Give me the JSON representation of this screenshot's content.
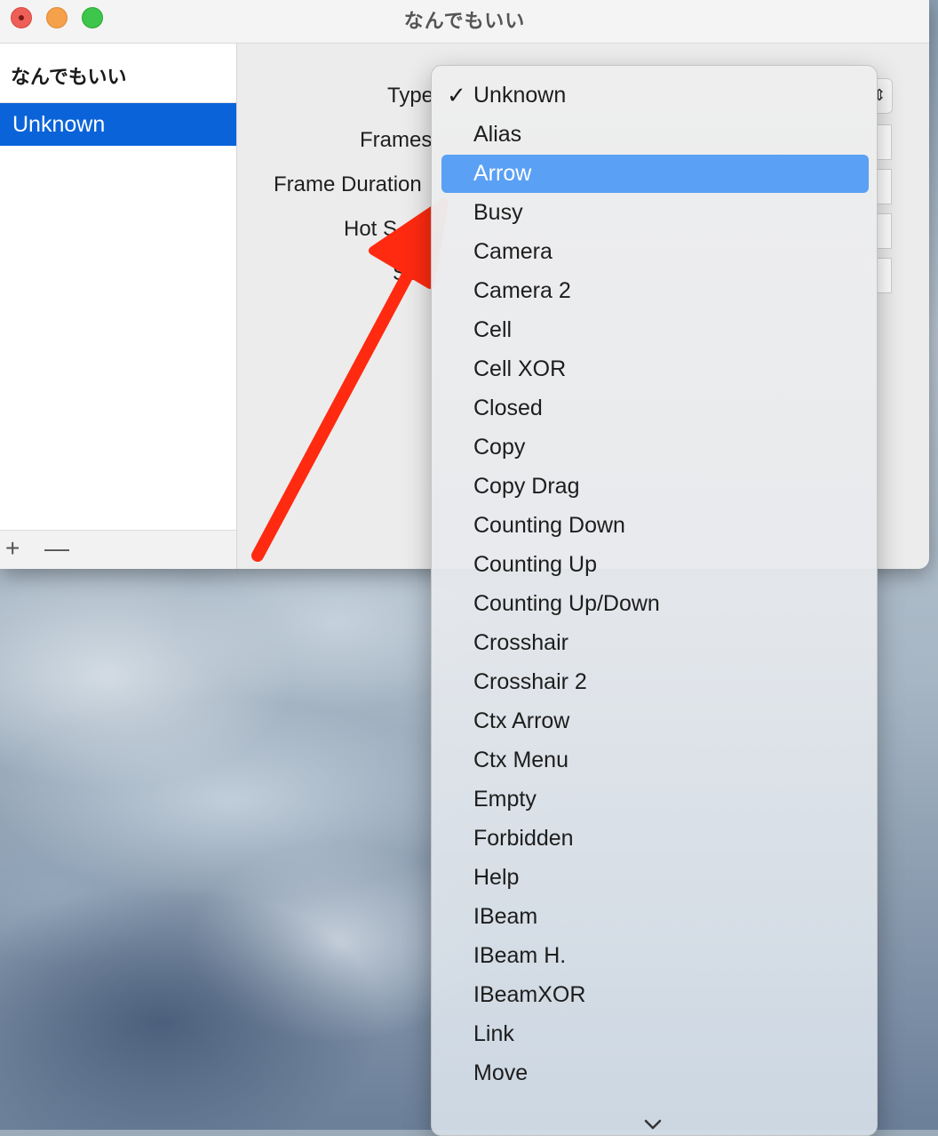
{
  "window": {
    "title": "なんでもいい"
  },
  "sidebar": {
    "header": "なんでもいい",
    "items": [
      {
        "label": "Unknown",
        "selected": true
      }
    ],
    "add_label": "+",
    "remove_label": "—"
  },
  "form": {
    "labels": {
      "type": "Type",
      "frames": "Frames",
      "frame_duration": "Frame Duration",
      "hot_spot": "Hot S",
      "size": "Size"
    }
  },
  "menu": {
    "selected": "Unknown",
    "highlighted": "Arrow",
    "check_glyph": "✓",
    "items": [
      "Unknown",
      "Alias",
      "Arrow",
      "Busy",
      "Camera",
      "Camera 2",
      "Cell",
      "Cell XOR",
      "Closed",
      "Copy",
      "Copy Drag",
      "Counting Down",
      "Counting Up",
      "Counting Up/Down",
      "Crosshair",
      "Crosshair 2",
      "Ctx Arrow",
      "Ctx Menu",
      "Empty",
      "Forbidden",
      "Help",
      "IBeam",
      "IBeam H.",
      "IBeamXOR",
      "Link",
      "Move"
    ]
  },
  "colors": {
    "selection_blue": "#0a63d9",
    "menu_highlight": "#5aa0f5",
    "annotation_red": "#ff2a10"
  },
  "icons": {
    "popup": "chevron-up-down-icon",
    "scroll_down": "chevron-down-icon",
    "checkmark": "checkmark-icon"
  }
}
